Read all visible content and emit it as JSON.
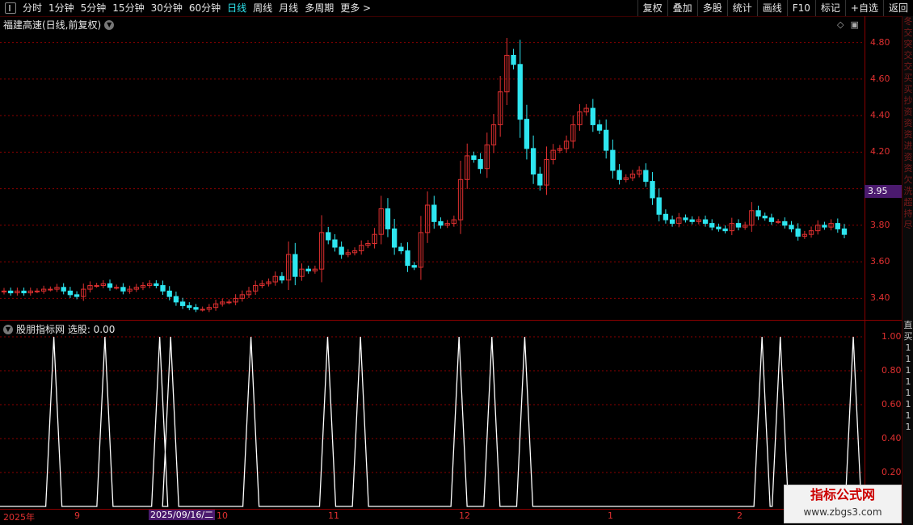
{
  "toolbar": {
    "periods": [
      "分时",
      "1分钟",
      "5分钟",
      "15分钟",
      "30分钟",
      "60分钟",
      "日线",
      "周线",
      "月线",
      "多周期",
      "更多 >"
    ],
    "active_index": 6,
    "right_buttons": [
      "复权",
      "叠加",
      "多股",
      "统计",
      "画线",
      "F10",
      "标记",
      "+自选",
      "返回"
    ]
  },
  "chart": {
    "title": "福建高速(日线,前复权)",
    "price_ticks": [
      "4.80",
      "4.60",
      "4.40",
      "4.20",
      "4.00",
      "3.80",
      "3.60",
      "3.40"
    ],
    "current_price": "3.95",
    "indicator_title": "股朋指标网 选股: 0.00",
    "indicator_ticks": [
      "1.00",
      "0.80",
      "0.60",
      "0.40",
      "0.20"
    ],
    "dates": [
      "2025年",
      "9",
      "10",
      "11",
      "12",
      "1",
      "2"
    ],
    "selected_date": "2025/09/16/二",
    "colors": {
      "up": "#e03030",
      "down": "#2ee6f0",
      "grid": "#8b0000",
      "signal": "#ffffff"
    }
  },
  "right_strip": {
    "chars": [
      "冬",
      "交",
      "突",
      "交",
      "交",
      "买",
      "买",
      "抄",
      "资",
      "资",
      "资",
      "进",
      "资",
      "资",
      "欠",
      "洗",
      "超",
      "持",
      "尽"
    ],
    "ind_chars": [
      "直",
      "买",
      "1",
      "1",
      "1",
      "1",
      "1",
      "1",
      "1",
      "1"
    ]
  },
  "watermark": {
    "line1": "指标公式网",
    "line2": "www.zbgs3.com"
  },
  "chart_data": {
    "type": "candlestick",
    "title": "福建高速(日线,前复权)",
    "ylim": [
      3.3,
      4.9
    ],
    "price_series": [
      3.44,
      3.43,
      3.44,
      3.43,
      3.44,
      3.44,
      3.45,
      3.45,
      3.46,
      3.44,
      3.42,
      3.41,
      3.45,
      3.47,
      3.47,
      3.48,
      3.46,
      3.46,
      3.44,
      3.45,
      3.46,
      3.47,
      3.48,
      3.47,
      3.44,
      3.41,
      3.38,
      3.36,
      3.35,
      3.34,
      3.34,
      3.35,
      3.37,
      3.38,
      3.38,
      3.4,
      3.42,
      3.44,
      3.47,
      3.48,
      3.49,
      3.52,
      3.5,
      3.64,
      3.52,
      3.56,
      3.55,
      3.56,
      3.76,
      3.72,
      3.68,
      3.64,
      3.65,
      3.66,
      3.69,
      3.7,
      3.75,
      3.89,
      3.78,
      3.68,
      3.66,
      3.58,
      3.57,
      3.76,
      3.91,
      3.82,
      3.8,
      3.81,
      3.83,
      4.05,
      4.18,
      4.16,
      4.11,
      4.24,
      4.35,
      4.53,
      4.73,
      4.68,
      4.38,
      4.22,
      4.08,
      4.02,
      4.16,
      4.21,
      4.22,
      4.26,
      4.35,
      4.42,
      4.44,
      4.35,
      4.32,
      4.21,
      4.1,
      4.05,
      4.06,
      4.08,
      4.1,
      4.04,
      3.95,
      3.86,
      3.83,
      3.81,
      3.84,
      3.83,
      3.82,
      3.83,
      3.81,
      3.79,
      3.78,
      3.77,
      3.81,
      3.79,
      3.8,
      3.88,
      3.85,
      3.84,
      3.82,
      3.82,
      3.8,
      3.78,
      3.74,
      3.75,
      3.77,
      3.8,
      3.79,
      3.81,
      3.78,
      3.75
    ],
    "price_ticks": [
      4.8,
      4.6,
      4.4,
      4.2,
      4.0,
      3.8,
      3.6,
      3.4
    ],
    "indicator": {
      "name": "选股",
      "value": 0.0,
      "ylim": [
        0,
        1
      ],
      "signal_bars": [
        7,
        21,
        36,
        39,
        61,
        82,
        91,
        118,
        127,
        136,
        201,
        206,
        226
      ]
    }
  }
}
